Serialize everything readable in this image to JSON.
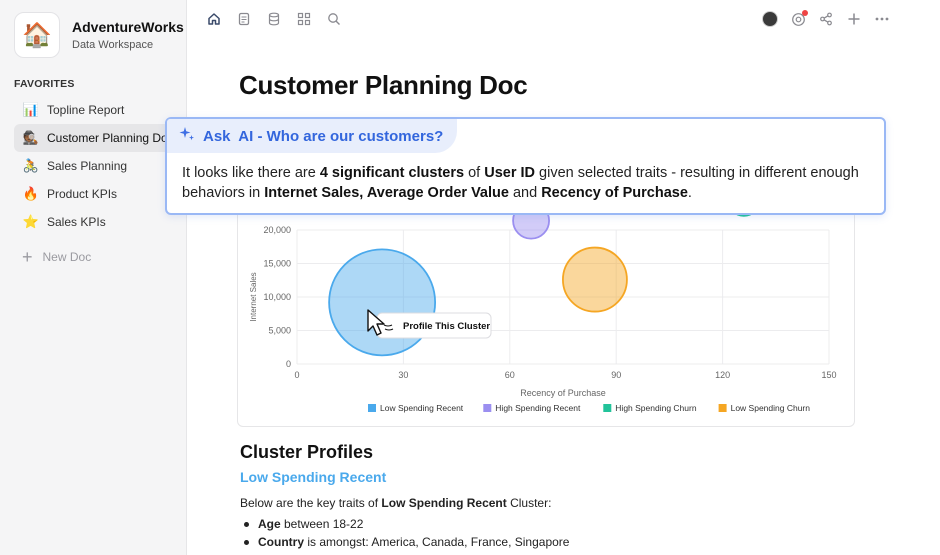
{
  "workspace": {
    "name": "AdventureWorks",
    "subtitle": "Data Workspace",
    "logo_icon": "house-icon"
  },
  "sidebar": {
    "favorites_label": "FAVORITES",
    "items": [
      {
        "label": "Topline Report",
        "icon": "📊",
        "active": false
      },
      {
        "label": "Customer Planning Doc",
        "icon": "🕵🏾",
        "active": true
      },
      {
        "label": "Sales Planning",
        "icon": "🚴",
        "active": false
      },
      {
        "label": "Product KPIs",
        "icon": "🔥",
        "active": false
      },
      {
        "label": "Sales KPIs",
        "icon": "⭐",
        "active": false
      }
    ],
    "new_doc_label": "New Doc"
  },
  "toolbar": {
    "left_icons": [
      "home-icon",
      "document-icon",
      "database-icon",
      "apps-icon",
      "search-icon"
    ],
    "right_icons": [
      "avatar",
      "mention-icon",
      "share-icon",
      "plus-icon",
      "more-icon"
    ]
  },
  "doc": {
    "title": "Customer Planning Doc"
  },
  "ai": {
    "header": "Ask  AI - Who are our customers?",
    "body": {
      "p1": "It looks like there are ",
      "b1": "4 significant clusters",
      "p2": " of ",
      "b2": "User ID",
      "p3": " given selected traits - resulting in different enough behaviors in ",
      "b3": "Internet Sales, Average Order Value",
      "p4": " and ",
      "b4": "Recency of Purchase",
      "p5": "."
    },
    "accent": "#3366dd"
  },
  "chart_data": {
    "type": "scatter",
    "xlabel": "Recency of Purchase",
    "ylabel": "Internet Sales",
    "xlim": [
      0,
      150
    ],
    "ylim": [
      0,
      20000
    ],
    "x_ticks": [
      0,
      30,
      60,
      90,
      120,
      150
    ],
    "y_ticks": [
      0,
      5000,
      10000,
      15000,
      20000
    ],
    "y_tick_labels": [
      "0",
      "5,000",
      "10,000",
      "15,000",
      "20,000"
    ],
    "grid": true,
    "legend_position": "bottom",
    "series": [
      {
        "name": "Low Spending Recent",
        "color": "#4aa9ec",
        "points": [
          {
            "x": 24,
            "y": 9200,
            "size": 53
          }
        ]
      },
      {
        "name": "High Spending Recent",
        "color": "#9b8ff0",
        "points": [
          {
            "x": 66,
            "y": 21400,
            "size": 18
          }
        ]
      },
      {
        "name": "High Spending Churn",
        "color": "#22c39a",
        "points": [
          {
            "x": 126,
            "y": 24500,
            "size": 16
          }
        ]
      },
      {
        "name": "Low Spending Churn",
        "color": "#f5a623",
        "points": [
          {
            "x": 84,
            "y": 12600,
            "size": 32
          }
        ]
      }
    ],
    "tooltip": "Profile This Cluster"
  },
  "profiles": {
    "heading": "Cluster Profiles",
    "cluster_name": "Low Spending Recent",
    "intro_prefix": "Below are the key traits of ",
    "intro_bold": "Low Spending Recent",
    "intro_suffix": " Cluster:",
    "traits": [
      {
        "name": "Age",
        "value": " between 18-22"
      },
      {
        "name": "Country",
        "value": " is amongst: America, Canada, France, Singapore"
      }
    ]
  }
}
